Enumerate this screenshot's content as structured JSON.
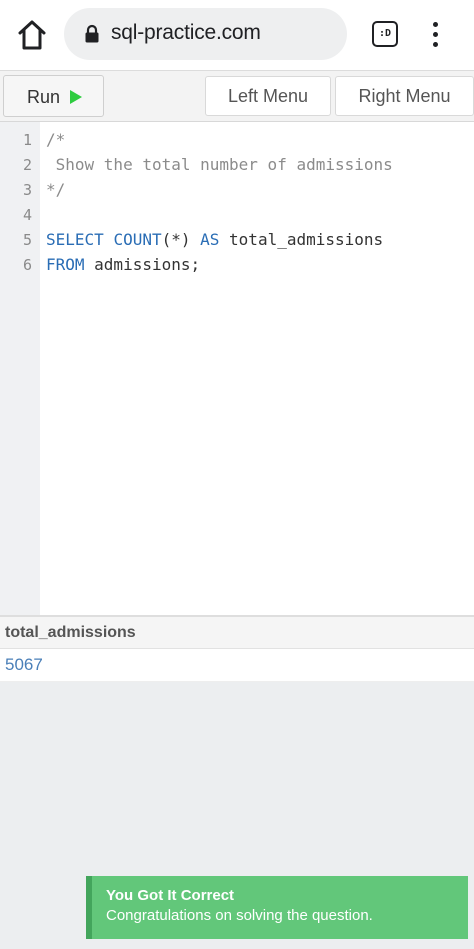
{
  "browser": {
    "url": "sql-practice.com",
    "tab_switcher_label": ":D",
    "home_icon": "home-icon",
    "lock_icon": "lock-icon",
    "menu_icon": "more-vert-icon"
  },
  "toolbar": {
    "run_label": "Run",
    "run_icon": "play-icon",
    "run_icon_color": "#2ecc40",
    "left_menu_label": "Left Menu",
    "right_menu_label": "Right Menu"
  },
  "editor": {
    "line_numbers": [
      "1",
      "2",
      "3",
      "4",
      "5",
      "6"
    ],
    "lines": {
      "l1": "/*",
      "l2": " Show the total number of admissions",
      "l3": "*/",
      "l5_select": "SELECT",
      "l5_count": "COUNT",
      "l5_args": "(*) ",
      "l5_as": "AS",
      "l5_alias": " total_admissions",
      "l6_from": "FROM",
      "l6_table": " admissions;"
    },
    "keyword_color": "#2a6db5",
    "comment_color": "#8b8b8b"
  },
  "results": {
    "columns": [
      "total_admissions"
    ],
    "rows": [
      [
        "5067"
      ]
    ],
    "value_color": "#4a7fb8"
  },
  "toast": {
    "title": "You Got It Correct",
    "message": "Congratulations on solving the question.",
    "color": "#62c77a"
  }
}
